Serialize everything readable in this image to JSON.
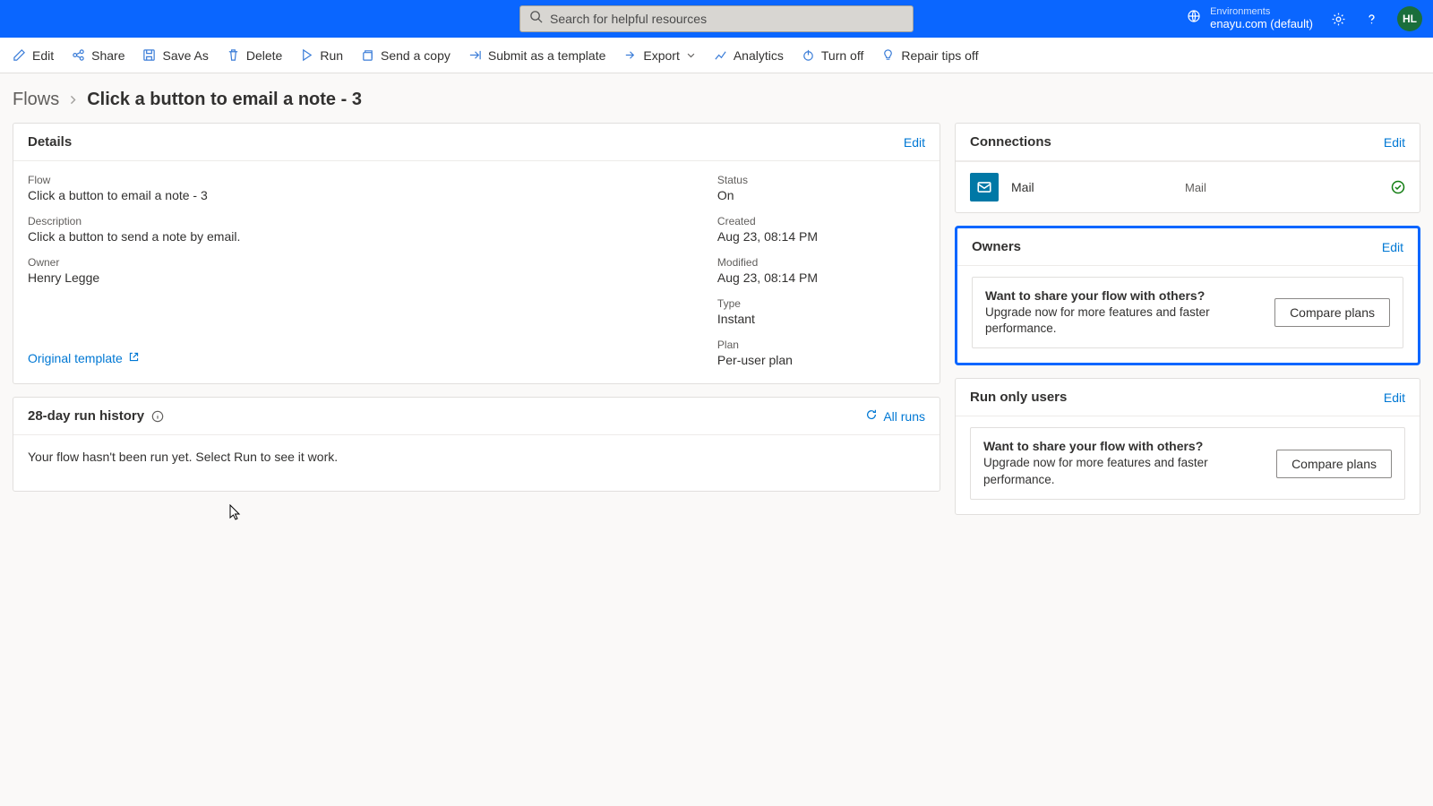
{
  "header": {
    "search_placeholder": "Search for helpful resources",
    "env_label": "Environments",
    "env_name": "enayu.com (default)",
    "avatar_initials": "HL"
  },
  "commands": {
    "edit": "Edit",
    "share": "Share",
    "save_as": "Save As",
    "delete": "Delete",
    "run": "Run",
    "send_copy": "Send a copy",
    "submit_template": "Submit as a template",
    "export": "Export",
    "analytics": "Analytics",
    "turn_off": "Turn off",
    "repair_tips_off": "Repair tips off"
  },
  "breadcrumb": {
    "root": "Flows",
    "current": "Click a button to email a note - 3"
  },
  "details": {
    "title": "Details",
    "edit": "Edit",
    "flow_lbl": "Flow",
    "flow_val": "Click a button to email a note - 3",
    "desc_lbl": "Description",
    "desc_val": "Click a button to send a note by email.",
    "owner_lbl": "Owner",
    "owner_val": "Henry Legge",
    "status_lbl": "Status",
    "status_val": "On",
    "created_lbl": "Created",
    "created_val": "Aug 23, 08:14 PM",
    "modified_lbl": "Modified",
    "modified_val": "Aug 23, 08:14 PM",
    "type_lbl": "Type",
    "type_val": "Instant",
    "plan_lbl": "Plan",
    "plan_val": "Per-user plan",
    "original_template": "Original template"
  },
  "history": {
    "title": "28-day run history",
    "all_runs": "All runs",
    "empty_msg": "Your flow hasn't been run yet. Select Run to see it work."
  },
  "connections": {
    "title": "Connections",
    "edit": "Edit",
    "items": [
      {
        "name": "Mail",
        "type": "Mail"
      }
    ]
  },
  "owners": {
    "title": "Owners",
    "edit": "Edit",
    "share_title": "Want to share your flow with others?",
    "share_sub": "Upgrade now for more features and faster performance.",
    "compare": "Compare plans"
  },
  "runonly": {
    "title": "Run only users",
    "edit": "Edit",
    "share_title": "Want to share your flow with others?",
    "share_sub": "Upgrade now for more features and faster performance.",
    "compare": "Compare plans"
  }
}
